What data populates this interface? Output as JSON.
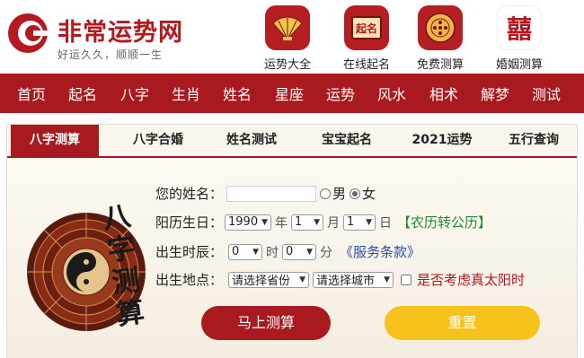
{
  "header": {
    "logo_title": "非常运势网",
    "logo_slogan": "好运久久，顺顺一生",
    "features": [
      {
        "label": "运势大全",
        "icon": "fan-icon"
      },
      {
        "label": "在线起名",
        "icon": "name-seal-icon"
      },
      {
        "label": "免费测算",
        "icon": "mooncake-icon"
      },
      {
        "label": "婚姻测算",
        "icon": "double-happiness-icon",
        "glyph": "囍"
      }
    ],
    "seal_text": "起名"
  },
  "nav": [
    "首页",
    "起名",
    "八字",
    "生肖",
    "姓名",
    "星座",
    "运势",
    "风水",
    "相术",
    "解梦",
    "测试"
  ],
  "tabs": [
    "八字测算",
    "八字合婚",
    "姓名测试",
    "宝宝起名",
    "2021运势",
    "五行查询"
  ],
  "active_tab": 0,
  "decor": {
    "calligraphy": [
      "八",
      "字",
      "测",
      "算"
    ]
  },
  "form": {
    "name_label": "您的姓名：",
    "name_value": "",
    "gender_male": "男",
    "gender_female": "女",
    "gender_selected": "女",
    "birthday_label": "阳历生日：",
    "year": "1990",
    "year_unit": "年",
    "month": "1",
    "month_unit": "月",
    "day": "1",
    "day_unit": "日",
    "lunar_link": "【农历转公历】",
    "time_label": "出生时辰：",
    "hour": "0",
    "hour_unit": "时",
    "minute": "0",
    "minute_unit": "分",
    "terms_link": "《服务条款》",
    "place_label": "出生地点：",
    "province_placeholder": "请选择省份",
    "city_placeholder": "请选择城市",
    "solar_time_label": "是否考虑真太阳时",
    "solar_time_checked": false
  },
  "buttons": {
    "submit": "马上测算",
    "reset": "重置"
  },
  "colors": {
    "brand_red": "#a81a1f",
    "reset_yellow": "#f7c21c",
    "link_green": "#1f8a2e",
    "link_blue": "#2a4ea8"
  }
}
